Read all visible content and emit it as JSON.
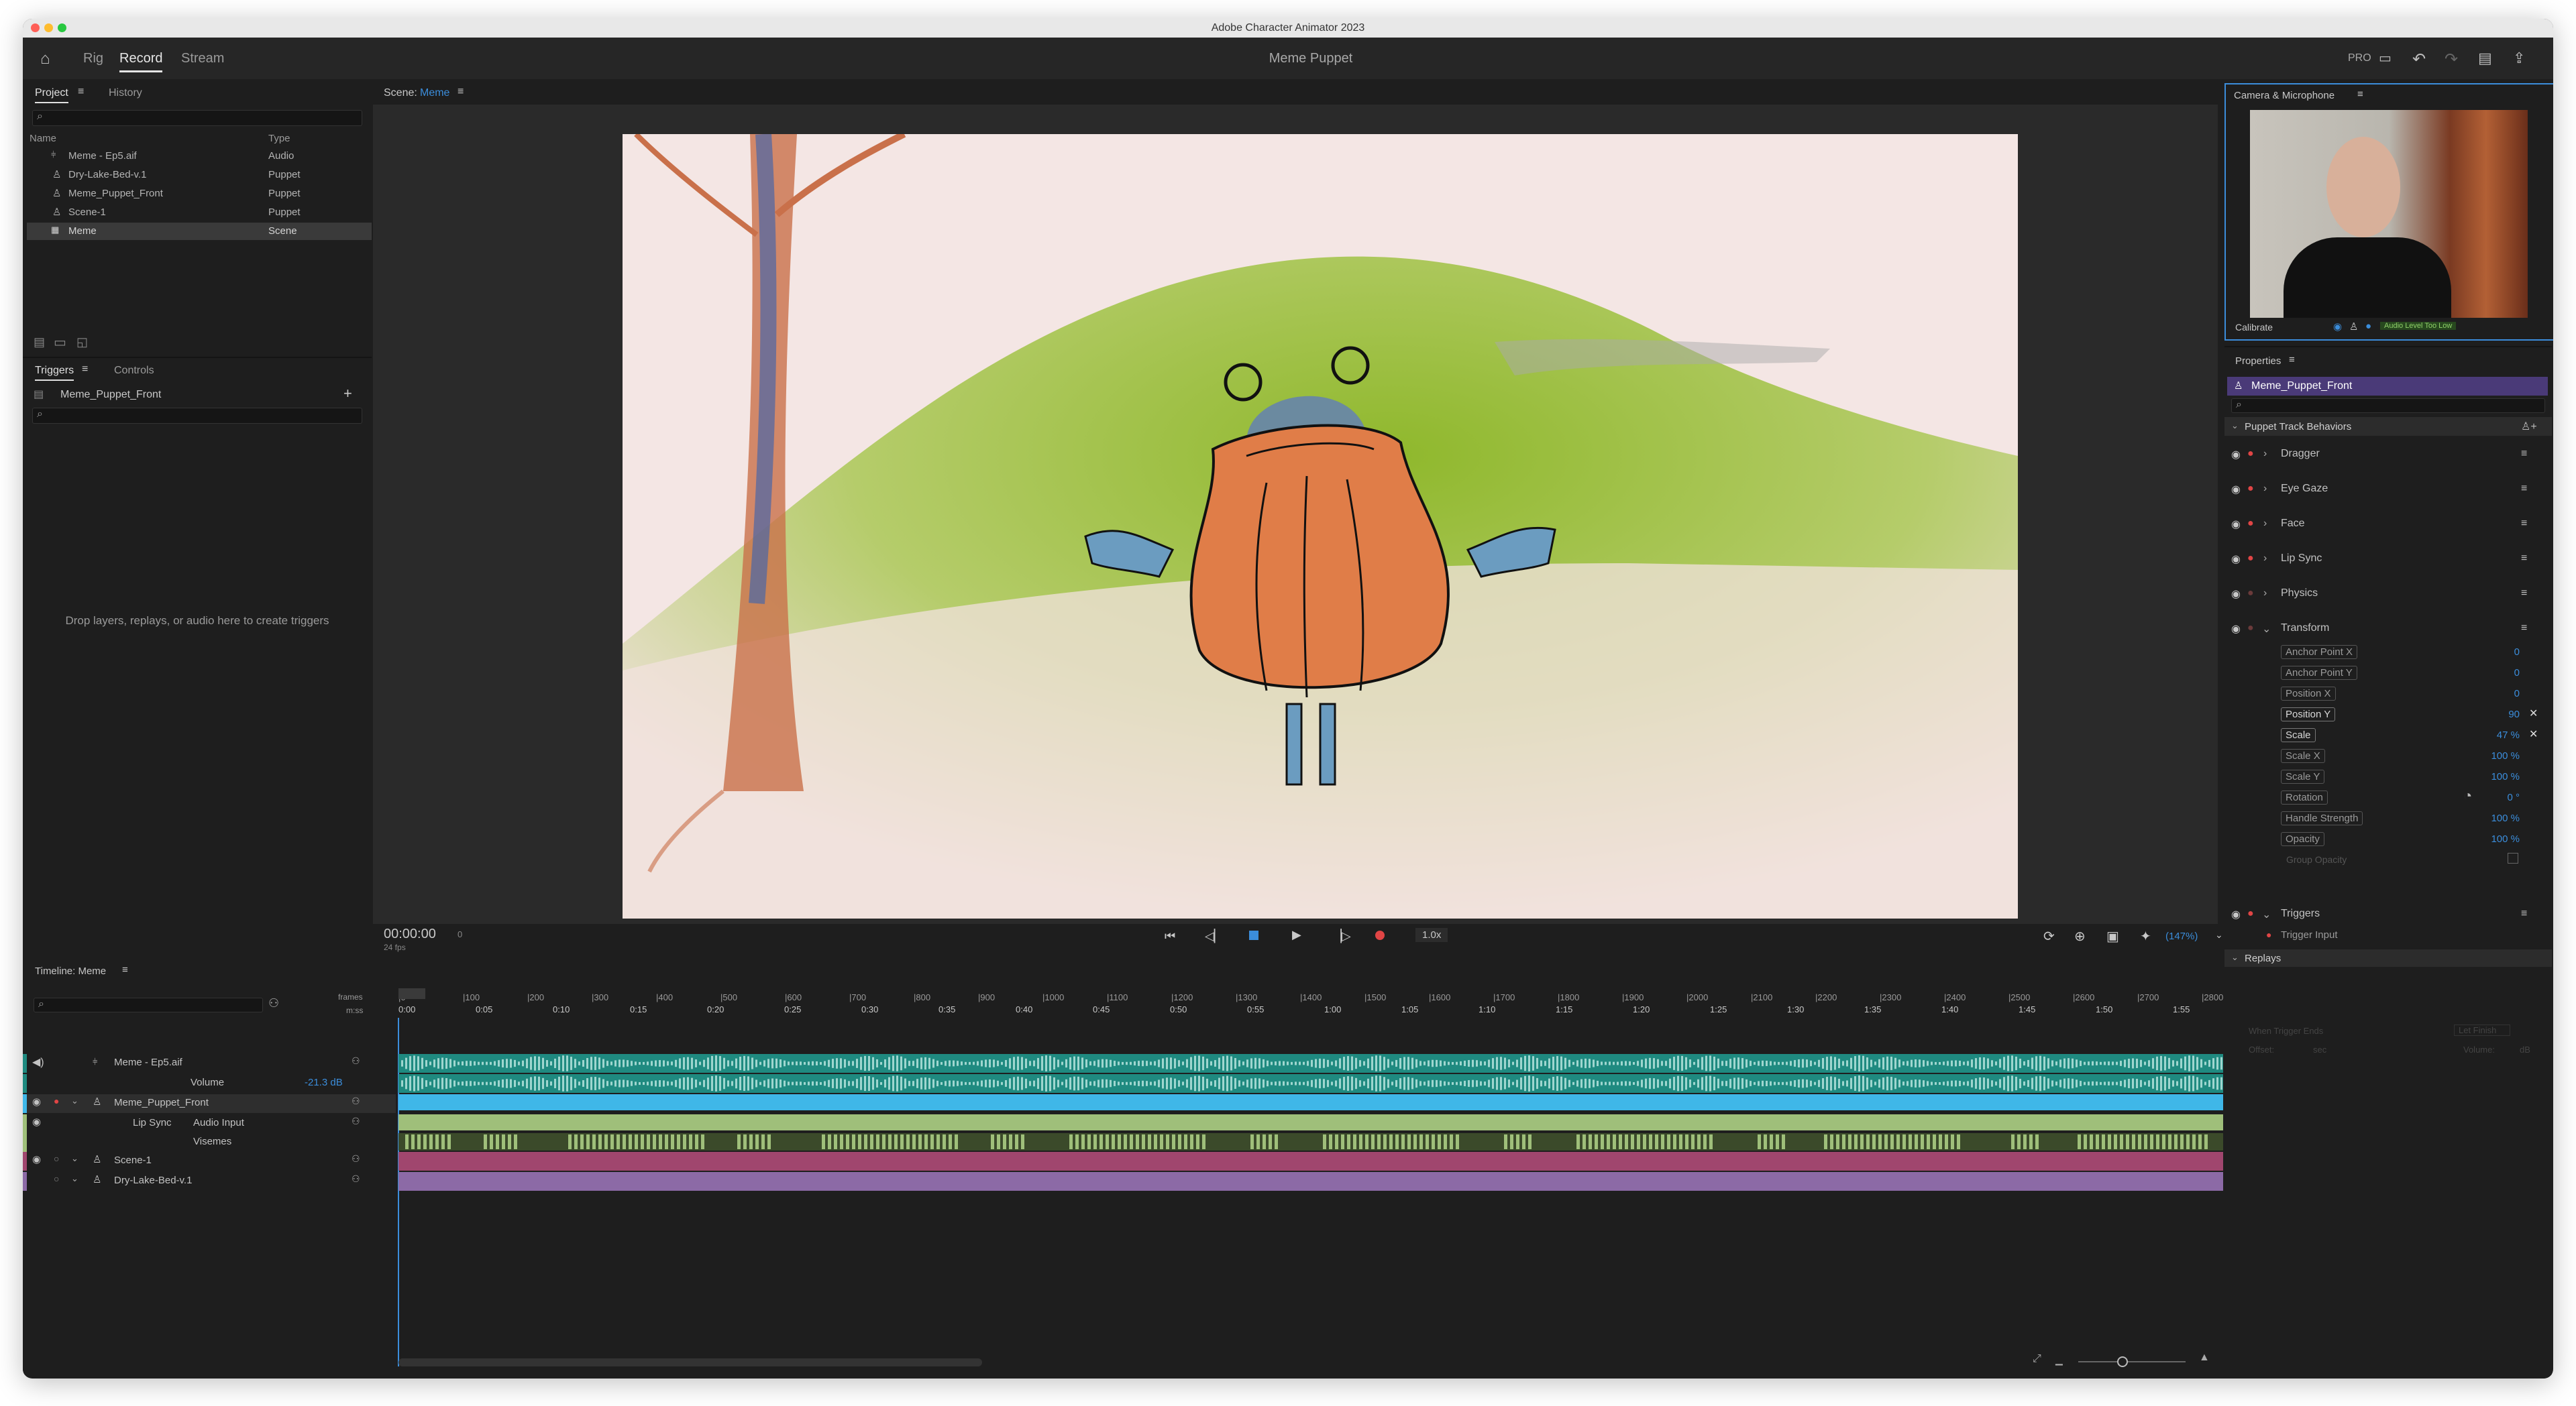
{
  "window": {
    "title": "Adobe Character Animator 2023"
  },
  "header": {
    "tabs": [
      "Rig",
      "Record",
      "Stream"
    ],
    "active_tab": "Record",
    "doc_title": "Meme Puppet",
    "pro_label": "PRO",
    "icons": [
      "home-icon",
      "workspace-icon",
      "undo-icon",
      "redo-icon",
      "feedback-icon",
      "share-icon"
    ]
  },
  "project": {
    "tabs": [
      "Project",
      "History"
    ],
    "columns": [
      "Name",
      "Type"
    ],
    "items": [
      {
        "name": "Meme - Ep5.aif",
        "type": "Audio"
      },
      {
        "name": "Dry-Lake-Bed-v.1",
        "type": "Puppet"
      },
      {
        "name": "Meme_Puppet_Front",
        "type": "Puppet"
      },
      {
        "name": "Scene-1",
        "type": "Puppet"
      },
      {
        "name": "Meme",
        "type": "Scene"
      }
    ]
  },
  "triggers": {
    "tabs": [
      "Triggers",
      "Controls"
    ],
    "puppet": "Meme_Puppet_Front",
    "empty_text": "Drop layers, replays, or audio here to create triggers"
  },
  "scene": {
    "label": "Scene:",
    "name": "Meme",
    "timecode": "00:00:00",
    "frame": "0",
    "fps": "24 fps",
    "speed": "1.0x",
    "zoom": "(147%)"
  },
  "camera": {
    "title": "Camera & Microphone",
    "calibrate": "Calibrate",
    "audio_level": "Audio Level Too Low"
  },
  "properties": {
    "title": "Properties",
    "puppet": "Meme_Puppet_Front",
    "section": "Puppet Track Behaviors",
    "behaviors": [
      "Dragger",
      "Eye Gaze",
      "Face",
      "Lip Sync",
      "Physics",
      "Transform"
    ],
    "params": [
      {
        "name": "Anchor Point X",
        "value": "0"
      },
      {
        "name": "Anchor Point Y",
        "value": "0"
      },
      {
        "name": "Position X",
        "value": "0"
      },
      {
        "name": "Position Y",
        "value": "90"
      },
      {
        "name": "Scale",
        "value": "47 %"
      },
      {
        "name": "Scale X",
        "value": "100 %"
      },
      {
        "name": "Scale Y",
        "value": "100 %"
      },
      {
        "name": "Rotation",
        "value": "0 °"
      },
      {
        "name": "Handle Strength",
        "value": "100 %"
      },
      {
        "name": "Opacity",
        "value": "100 %"
      },
      {
        "name": "Group Opacity",
        "value": ""
      }
    ],
    "triggers_label": "Triggers",
    "trigger_input": "Trigger Input",
    "replays_label": "Replays",
    "replays_when": "When Trigger Ends",
    "replays_when_value": "Let Finish",
    "replays_offset": "Offset:",
    "replays_offset_value": "sec",
    "replays_volume": "Volume:",
    "replays_volume_value": "dB"
  },
  "timeline": {
    "title": "Timeline: Meme",
    "frames_label": "frames",
    "mss_label": "m:ss",
    "frame_ticks": [
      "0",
      "100",
      "200",
      "300",
      "400",
      "500",
      "600",
      "700",
      "800",
      "900",
      "1000",
      "1100",
      "1200",
      "1300",
      "1400",
      "1500",
      "1600",
      "1700",
      "1800",
      "1900",
      "2000",
      "2100",
      "2200",
      "2300",
      "2400",
      "2500",
      "2600",
      "2700",
      "2800"
    ],
    "time_ticks": [
      "0:00",
      "0:05",
      "0:10",
      "0:15",
      "0:20",
      "0:25",
      "0:30",
      "0:35",
      "0:40",
      "0:45",
      "0:50",
      "0:55",
      "1:00",
      "1:05",
      "1:10",
      "1:15",
      "1:20",
      "1:25",
      "1:30",
      "1:35",
      "1:40",
      "1:45",
      "1:50",
      "1:55"
    ],
    "tracks": [
      {
        "name": "Meme - Ep5.aif"
      },
      {
        "name": "Volume",
        "value": "-21.3 dB"
      },
      {
        "name": "Meme_Puppet_Front"
      },
      {
        "name": "Lip Sync",
        "sub": "Audio Input"
      },
      {
        "name": "Visemes"
      },
      {
        "name": "Scene-1"
      },
      {
        "name": "Dry-Lake-Bed-v.1"
      }
    ]
  },
  "colors": {
    "accent": "#3b8ddb",
    "audio_track": "#1f8a80",
    "puppet_track": "#3fb7e8",
    "lipsync_track": "#9fbf7a",
    "scene_track": "#a0466e",
    "lake_track": "#8c6aa6"
  }
}
